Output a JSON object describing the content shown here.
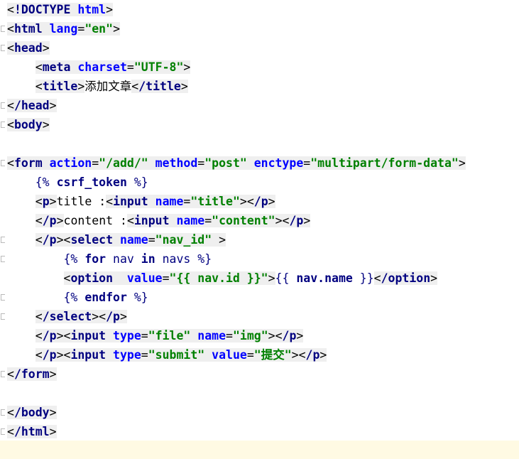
{
  "editor": {
    "lines": [
      "<!DOCTYPE html>",
      "<html lang=\"en\">",
      "<head>",
      "    <meta charset=\"UTF-8\">",
      "    <title>添加文章</title>",
      "</head>",
      "<body>",
      "",
      "<form action=\"/add/\" method=\"post\" enctype=\"multipart/form-data\">",
      "    {% csrf_token %}",
      "    <p>title :<input name=\"title\"></p>",
      "    </p>content :<input name=\"content\"></p>",
      "    </p><select name=\"nav_id\" >",
      "        {% for nav in navs %}",
      "        <option  value=\"{{ nav.id }}\">{{ nav.name }}</option>",
      "        {% endfor %}",
      "    </select></p>",
      "    </p><input type=\"file\" name=\"img\"></p>",
      "    </p><input type=\"submit\" value=\"提交\"></p>",
      "</form>",
      "",
      "</body>",
      "</html>"
    ]
  }
}
